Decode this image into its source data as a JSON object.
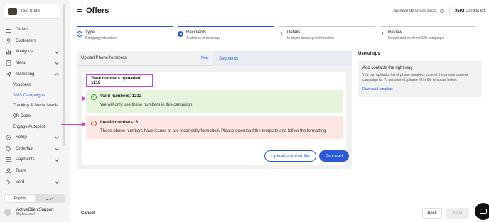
{
  "store": {
    "name": "Test Store"
  },
  "sidebar": {
    "items": [
      {
        "label": "Orders",
        "icon": "box-icon"
      },
      {
        "label": "Customers",
        "icon": "user-icon"
      },
      {
        "label": "Analytics",
        "icon": "chart-icon",
        "chevron": "down"
      },
      {
        "label": "Menu",
        "icon": "book-icon",
        "chevron": "down"
      },
      {
        "label": "Marketing",
        "icon": "send-icon",
        "chevron": "up"
      }
    ],
    "marketing_sub": [
      "Vouchers",
      "SMS Campaigns",
      "Tracking & Social Media",
      "QR Code",
      "Engage Autopilot"
    ],
    "items_after": [
      {
        "label": "Setup",
        "icon": "gear-icon",
        "chevron": "down"
      },
      {
        "label": "Orderfast",
        "icon": "tag-icon",
        "chevron": "down"
      },
      {
        "label": "Payments",
        "icon": "card-icon",
        "chevron": "down"
      },
      {
        "label": "Team",
        "icon": "team-icon"
      },
      {
        "label": "Verd",
        "icon": "chevron-icon",
        "chevron": "down"
      }
    ],
    "lang": {
      "en": "English",
      "ar": "عربي"
    },
    "user": {
      "name": "ActiveClientSupport",
      "sub": "My Account"
    }
  },
  "header": {
    "title": "Offers",
    "sender_label": "Sender ID",
    "sender_value": "OrderDirect",
    "credits_value": "3592",
    "credits_label": "Credits left"
  },
  "steps": [
    {
      "title": "Type",
      "sub": "Campaign objective",
      "state": "done"
    },
    {
      "title": "Recipients",
      "sub": "Audience of message",
      "state": "current"
    },
    {
      "title": "Details",
      "sub": "In-depth message information",
      "state": "todo",
      "num": "3"
    },
    {
      "title": "Review",
      "sub": "Revise and confirm SMS campaign",
      "state": "todo",
      "num": "4"
    }
  ],
  "main": {
    "tab_upload": "Upload Phone Numbers",
    "tab_upload_badge": "New",
    "tab_segments": "Segments",
    "total": "Total numbers uploaded: 1218",
    "valid_title": "Valid numbers: 1212",
    "valid_body": "We will only use these numbers in this campaign.",
    "invalid_title": "Invalid numbers: 6",
    "invalid_body": "These phone numbers have issues or are incorrectly formatted. Please download the template and follow the formatting",
    "upload_btn": "Upload another file",
    "proceed_btn": "Proceed"
  },
  "tips": {
    "title": "Useful tips",
    "heading": "Add contacts the right way",
    "body": "You can upload a list of phone numbers to send the announcement campaign to. To get started, please fill in the template below.",
    "link": "Download template"
  },
  "footer": {
    "cancel": "Cancel",
    "back": "Back",
    "next": "Next"
  },
  "colors": {
    "accent": "#2c59d6",
    "annotation": "#d63fd3",
    "success_bg": "#e6f4dc",
    "error_bg": "#fde7e3"
  }
}
